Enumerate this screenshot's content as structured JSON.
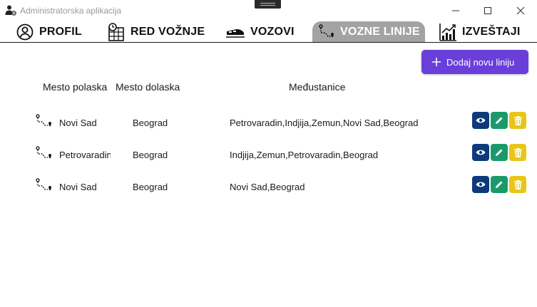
{
  "window": {
    "title": "Administratorska aplikacija"
  },
  "tabs": [
    {
      "label": "PROFIL",
      "icon": "user-circle-icon",
      "active": false
    },
    {
      "label": "RED VOŽNJE",
      "icon": "timetable-clock-icon",
      "active": false
    },
    {
      "label": "VOZOVI",
      "icon": "train-icon",
      "active": false
    },
    {
      "label": "VOZNE LINIJE",
      "icon": "route-icon",
      "active": true
    },
    {
      "label": "IZVEŠTAJI",
      "icon": "report-chart-icon",
      "active": false
    }
  ],
  "add_button": {
    "label": "Dodaj novu liniju",
    "icon": "plus-icon"
  },
  "table": {
    "headers": [
      "Mesto polaska",
      "Mesto dolaska",
      "Međustanice"
    ],
    "rows": [
      {
        "from": "Novi Sad",
        "to": "Beograd",
        "stops": "Petrovaradin,Indjija,Zemun,Novi Sad,Beograd"
      },
      {
        "from": "Petrovaradin",
        "to": "Beograd",
        "stops": "Indjija,Zemun,Petrovaradin,Beograd"
      },
      {
        "from": "Novi Sad",
        "to": "Beograd",
        "stops": "Novi Sad,Beograd"
      }
    ],
    "row_actions": [
      {
        "name": "view",
        "icon": "eye-icon",
        "color": "#0d3a7a"
      },
      {
        "name": "edit",
        "icon": "pencil-icon",
        "color": "#1a9a6b"
      },
      {
        "name": "delete",
        "icon": "trash-icon",
        "color": "#e8c51a"
      }
    ]
  },
  "colors": {
    "accent": "#6a3fd9",
    "active_tab": "#a3a3a3"
  }
}
